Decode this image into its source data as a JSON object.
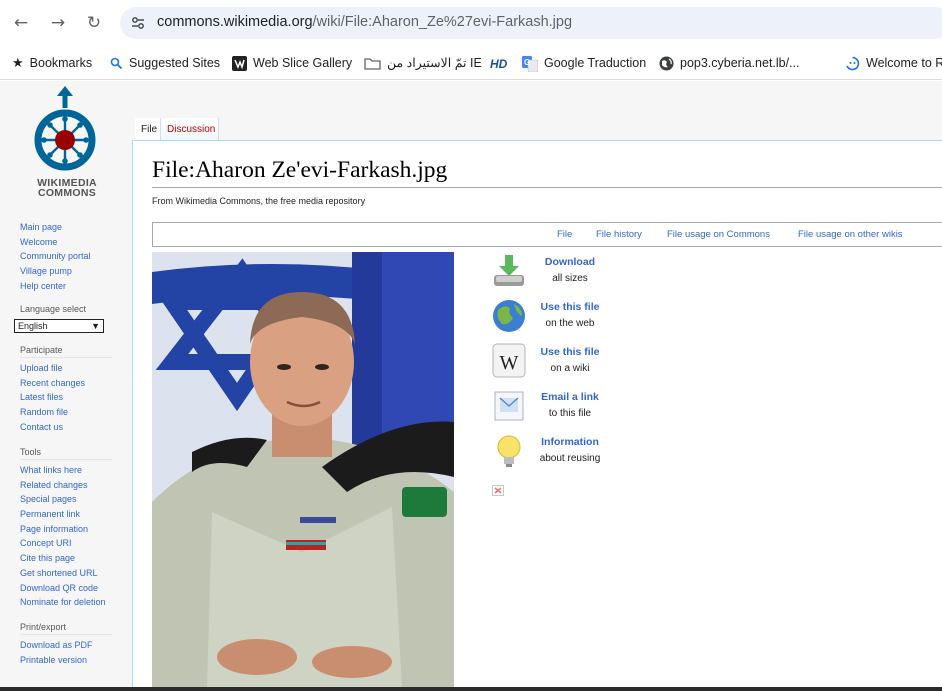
{
  "browser": {
    "url_host": "commons.wikimedia.org",
    "url_path": "/wiki/File:Aharon_Ze%27evi-Farkash.jpg",
    "bookmarks": [
      {
        "label": "Bookmarks",
        "icon": "star-icon"
      },
      {
        "label": "Suggested Sites",
        "icon": "search-icon"
      },
      {
        "label": "Web Slice Gallery",
        "icon": "web-slice-icon"
      },
      {
        "label": "تمّ الاستيراد من IE",
        "icon": "folder-icon"
      },
      {
        "label": "",
        "icon": "hd-icon"
      },
      {
        "label": "Google Traduction",
        "icon": "google-translate-icon"
      },
      {
        "label": "pop3.cyberia.net.lb/...",
        "icon": "globe-icon"
      },
      {
        "label": "Welcome to R",
        "icon": "loop-icon"
      }
    ]
  },
  "logo": {
    "line1": "WIKIMEDIA",
    "line2": "COMMONS",
    "brand_color": "#006699",
    "dot_color": "#990000"
  },
  "sidebar": {
    "nav": [
      "Main page",
      "Welcome",
      "Community portal",
      "Village pump",
      "Help center"
    ],
    "language_label": "Language select",
    "language_value": "English",
    "participate": {
      "heading": "Participate",
      "items": [
        "Upload file",
        "Recent changes",
        "Latest files",
        "Random file",
        "Contact us"
      ]
    },
    "tools": {
      "heading": "Tools",
      "items": [
        "What links here",
        "Related changes",
        "Special pages",
        "Permanent link",
        "Page information",
        "Concept URI",
        "Cite this page",
        "Get shortened URL",
        "Download QR code",
        "Nominate for deletion"
      ]
    },
    "print": {
      "heading": "Print/export",
      "items": [
        "Download as PDF",
        "Printable version"
      ]
    }
  },
  "tabs": {
    "file": "File",
    "discussion": "Discussion"
  },
  "page": {
    "title": "File:Aharon Ze'evi-Farkash.jpg",
    "tagline": "From Wikimedia Commons, the free media repository"
  },
  "filetoc": [
    "File",
    "File history",
    "File usage on Commons",
    "File usage on other wikis"
  ],
  "actions": [
    {
      "title": "Download",
      "sub": "all sizes",
      "icon": "download-icon"
    },
    {
      "title": "Use this file",
      "sub": "on the web",
      "icon": "globe-icon"
    },
    {
      "title": "Use this file",
      "sub": "on a wiki",
      "icon": "wikipedia-icon"
    },
    {
      "title": "Email a link",
      "sub": "to this file",
      "icon": "email-link-icon"
    },
    {
      "title": "Information",
      "sub": "about reusing",
      "icon": "lightbulb-icon"
    }
  ],
  "colors": {
    "link": "#3366cc",
    "red_link": "#ba0000",
    "accent_border": "#a7d7f9"
  }
}
